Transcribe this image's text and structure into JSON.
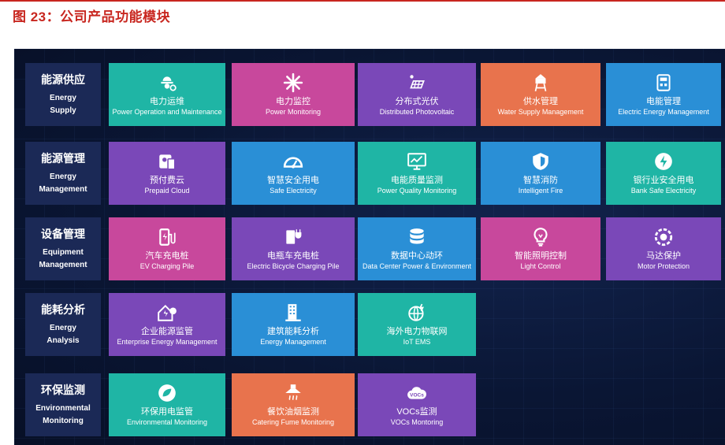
{
  "figure_title": "图 23：公司产品功能模块",
  "categories": [
    {
      "zh": "能源供应",
      "en1": "Energy",
      "en2": "Supply"
    },
    {
      "zh": "能源管理",
      "en1": "Energy",
      "en2": "Management"
    },
    {
      "zh": "设备管理",
      "en1": "Equipment",
      "en2": "Management"
    },
    {
      "zh": "能耗分析",
      "en1": "Energy",
      "en2": "Analysis"
    },
    {
      "zh": "环保监测",
      "en1": "Environmental",
      "en2": "Monitoring"
    }
  ],
  "rows": [
    [
      {
        "zh": "电力运维",
        "en": "Power Operation and Maintenance",
        "color": "#1fb5a5",
        "icon": "worker-icon"
      },
      {
        "zh": "电力监控",
        "en": "Power Monitoring",
        "color": "#c8489c",
        "icon": "spark-icon"
      },
      {
        "zh": "分布式光伏",
        "en": "Distributed Photovoltaic",
        "color": "#7a48b8",
        "icon": "solar-panel-icon"
      },
      {
        "zh": "供水管理",
        "en": "Water Supply Management",
        "color": "#e8734d",
        "icon": "water-tower-icon"
      },
      {
        "zh": "电能管理",
        "en": "Electric Energy Management",
        "color": "#2a8fd6",
        "icon": "meter-icon"
      }
    ],
    [
      {
        "zh": "预付费云",
        "en": "Prepaid Cloud",
        "color": "#7a48b8",
        "icon": "prepaid-icon"
      },
      {
        "zh": "智慧安全用电",
        "en": "Safe Electricity",
        "color": "#2a8fd6",
        "icon": "gauge-icon"
      },
      {
        "zh": "电能质量监测",
        "en": "Power Quality Monitoring",
        "color": "#1fb5a5",
        "icon": "monitor-chart-icon"
      },
      {
        "zh": "智慧消防",
        "en": "Intelligent Fire",
        "color": "#2a8fd6",
        "icon": "shield-icon"
      },
      {
        "zh": "银行业安全用电",
        "en": "Bank Safe Electricity",
        "color": "#1fb5a5",
        "icon": "bolt-circle-icon"
      }
    ],
    [
      {
        "zh": "汽车充电桩",
        "en": "EV Charging Pile",
        "color": "#c8489c",
        "icon": "ev-charger-icon"
      },
      {
        "zh": "电瓶车充电桩",
        "en": "Electric Bicycle Charging Pile",
        "color": "#7a48b8",
        "icon": "plug-charger-icon"
      },
      {
        "zh": "数据中心动环",
        "en": "Data Center Power & Environment",
        "color": "#2a8fd6",
        "icon": "database-icon"
      },
      {
        "zh": "智能照明控制",
        "en": "Light Control",
        "color": "#c8489c",
        "icon": "bulb-icon"
      },
      {
        "zh": "马达保护",
        "en": "Motor Protection",
        "color": "#7a48b8",
        "icon": "motor-icon"
      }
    ],
    [
      {
        "zh": "企业能源监管",
        "en": "Enterprise Energy Management",
        "color": "#7a48b8",
        "icon": "home-energy-icon"
      },
      {
        "zh": "建筑能耗分析",
        "en": "Energy Management",
        "color": "#2a8fd6",
        "icon": "building-icon"
      },
      {
        "zh": "海外电力物联网",
        "en": "IoT EMS",
        "color": "#1fb5a5",
        "icon": "globe-icon"
      }
    ],
    [
      {
        "zh": "环保用电监管",
        "en": "Environmental Monitoring",
        "color": "#1fb5a5",
        "icon": "leaf-icon"
      },
      {
        "zh": "餐饮油烟监测",
        "en": "Catering Fume Monitoring",
        "color": "#e8734d",
        "icon": "range-hood-icon"
      },
      {
        "zh": "VOCs监测",
        "en": "VOCs Montoring",
        "color": "#7a48b8",
        "icon": "vocs-cloud-icon"
      }
    ]
  ]
}
